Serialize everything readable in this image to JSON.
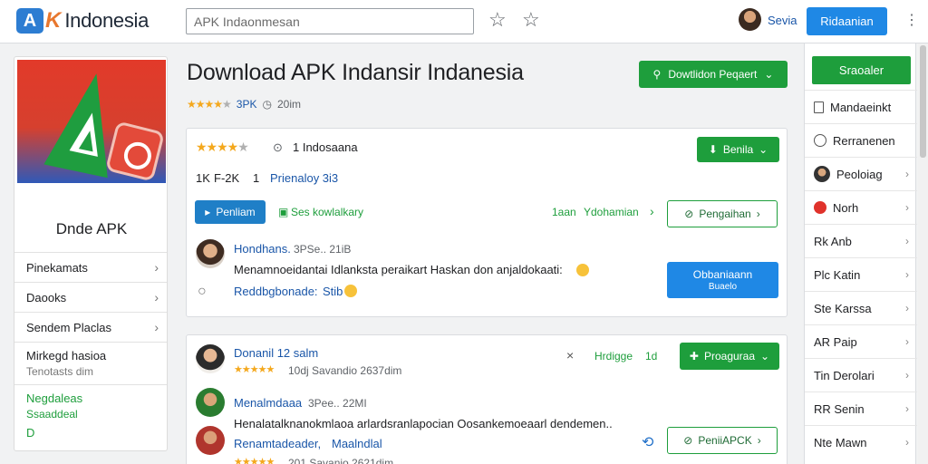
{
  "brand": {
    "mark": "A",
    "k": "K",
    "name": "Indonesia"
  },
  "search": {
    "placeholder": "APK Indaonmesan"
  },
  "topbar": {
    "star_icon_1": "star-outline",
    "star_icon_2": "star-outline",
    "user": "Sevia",
    "button": "Ridaanian",
    "more": "⋮"
  },
  "left": {
    "app_name": "Dnde APK",
    "items": [
      {
        "label": "Pinekamats"
      },
      {
        "label": "Daooks"
      },
      {
        "label": "Sendem Placlas"
      }
    ],
    "block1": {
      "title": "Mirkegd hasioa",
      "subtitle": "Tenotasts dim"
    },
    "block2": {
      "title": "Negdaleas",
      "subtitle": "Ssaaddeal",
      "extra": "D"
    }
  },
  "main": {
    "title": "Download APK Indansir Indanesia",
    "rating_text": "3PK",
    "time": "20im",
    "download_button": "Dowtlidon Peqaert"
  },
  "card1": {
    "rating_label": "1 Indosaana",
    "stats_a": "1K",
    "stats_b": "F-2K",
    "stats_c": "1",
    "stats_link": "Prienaloy 3i3",
    "button_right": "Benila",
    "button_left": "Penliam",
    "secondary": "Ses kowlalkary",
    "meta_1": "1aan",
    "meta_2": "Ydohamian",
    "meta_arrow": "›",
    "outline_button": "Pengaihan",
    "comment_user": "Hondhans.",
    "comment_meta": "3PSe.. 21iB",
    "comment_text": "Menamnoeidantai Idlanksta peraikart Haskan don anjaldokaati:",
    "comment_link": "Reddbgbonade:",
    "comment_link_b": "Stib",
    "blue_button_1": "Obbaniaann",
    "blue_button_2": "Buaelo"
  },
  "card2": {
    "user1": "Donanil 12 salm",
    "user1_meta": "10dj Savandio 2637dim",
    "close": "×",
    "meta_label": "Hrdigge",
    "meta_num": "1d",
    "green_button": "Proaguraa",
    "user2": "Menalmdaaa",
    "user2_meta": "3Pee.. 22MI",
    "comment_text": "Henalatalknanokmlaoa arlardsranlapocian Oosankemoeaarl dendemen..",
    "comment_link": "Renamtadeader,",
    "comment_link_b": "Maalndlal",
    "user3_meta": "201 Savanio 2621dim",
    "outline_button": "PeniiAPCK"
  },
  "right": {
    "top_button": "Sraoaler",
    "items": [
      {
        "label": "Mandaeinkt",
        "icon": "document-icon"
      },
      {
        "label": "Rerranenen",
        "icon": "minus-circle-icon"
      },
      {
        "label": "Peoloiag",
        "icon": "avatar-icon"
      },
      {
        "label": "Norh",
        "icon": "youtube-icon"
      },
      {
        "label": "Rk Anb",
        "icon": ""
      },
      {
        "label": "Plc Katin",
        "icon": ""
      },
      {
        "label": "Ste Karssa",
        "icon": ""
      },
      {
        "label": "AR Paip",
        "icon": ""
      },
      {
        "label": "Tin Derolari",
        "icon": ""
      },
      {
        "label": "RR Senin",
        "icon": ""
      },
      {
        "label": "Nte Mawn",
        "icon": ""
      }
    ]
  },
  "colors": {
    "green": "#1e9e3c",
    "blue": "#1f88e5",
    "star": "#f4a81d"
  }
}
